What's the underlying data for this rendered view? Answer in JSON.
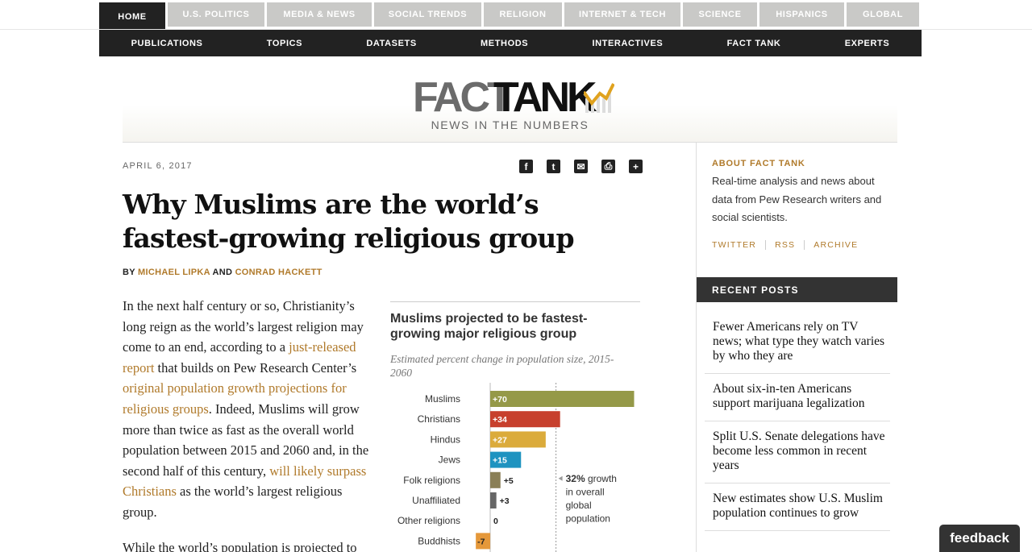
{
  "topnav": [
    "HOME",
    "U.S. POLITICS",
    "MEDIA & NEWS",
    "SOCIAL TRENDS",
    "RELIGION",
    "INTERNET & TECH",
    "SCIENCE",
    "HISPANICS",
    "GLOBAL"
  ],
  "subnav": [
    "PUBLICATIONS",
    "TOPICS",
    "DATASETS",
    "METHODS",
    "INTERACTIVES",
    "FACT TANK",
    "EXPERTS"
  ],
  "masthead": {
    "logo_a": "FACT",
    "logo_b": "TANK",
    "tagline": "NEWS IN THE NUMBERS"
  },
  "article": {
    "date": "APRIL 6, 2017",
    "title": "Why Muslims are the world’s fastest-growing religious group",
    "by": "BY",
    "and": "AND",
    "author1": "MICHAEL LIPKA",
    "author2": "CONRAD HACKETT",
    "p1_a": "In the next half century or so, Christianity’s long reign as the world’s largest religion may come to an end, according to a ",
    "p1_link1": "just-released report",
    "p1_b": " that builds on Pew Research Center’s ",
    "p1_link2": "original population growth projections for religious groups",
    "p1_c": ". Indeed, Muslims will grow more than twice as fast as the overall world population between 2015 and 2060 and, in the second half of this century, ",
    "p1_link3": "will likely surpass Christians",
    "p1_d": " as the world’s largest religious group.",
    "p2": "While the world’s population is projected to"
  },
  "share_icons": [
    "facebook-icon",
    "twitter-icon",
    "email-icon",
    "print-icon",
    "plus-icon"
  ],
  "chart_data": {
    "type": "bar",
    "title": "Muslims projected to be fastest-growing major religious group",
    "subtitle": "Estimated percent change in population size, 2015-2060",
    "categories": [
      "Muslims",
      "Christians",
      "Hindus",
      "Jews",
      "Folk religions",
      "Unaffiliated",
      "Other religions",
      "Buddhists"
    ],
    "values": [
      70,
      34,
      27,
      15,
      5,
      3,
      0,
      -7
    ],
    "labels": [
      "+70",
      "+34",
      "+27",
      "+15",
      "+5",
      "+3",
      "0",
      "-7"
    ],
    "colors": [
      "#959948",
      "#c7402d",
      "#dbab3b",
      "#1e93c0",
      "#8a7f56",
      "#666666",
      "#999999",
      "#e5983a"
    ],
    "reference_line": {
      "value": 32,
      "bold": "32%",
      "text": "growth in overall global population"
    },
    "xlim": [
      -7,
      70
    ]
  },
  "sidebar": {
    "about_heading": "ABOUT FACT TANK",
    "about_text": "Real-time analysis and news about data from Pew Research writers and social scientists.",
    "links": [
      "TWITTER",
      "RSS",
      "ARCHIVE"
    ],
    "recent_heading": "RECENT POSTS",
    "recent": [
      "Fewer Americans rely on TV news; what type they watch varies by who they are",
      "About six-in-ten Americans support marijuana legalization",
      "Split U.S. Senate delegations have become less common in recent years",
      "New estimates show U.S. Muslim population continues to grow"
    ]
  },
  "feedback": "feedback",
  "colors": {
    "accent": "#b07a2b",
    "dark": "#222222"
  }
}
